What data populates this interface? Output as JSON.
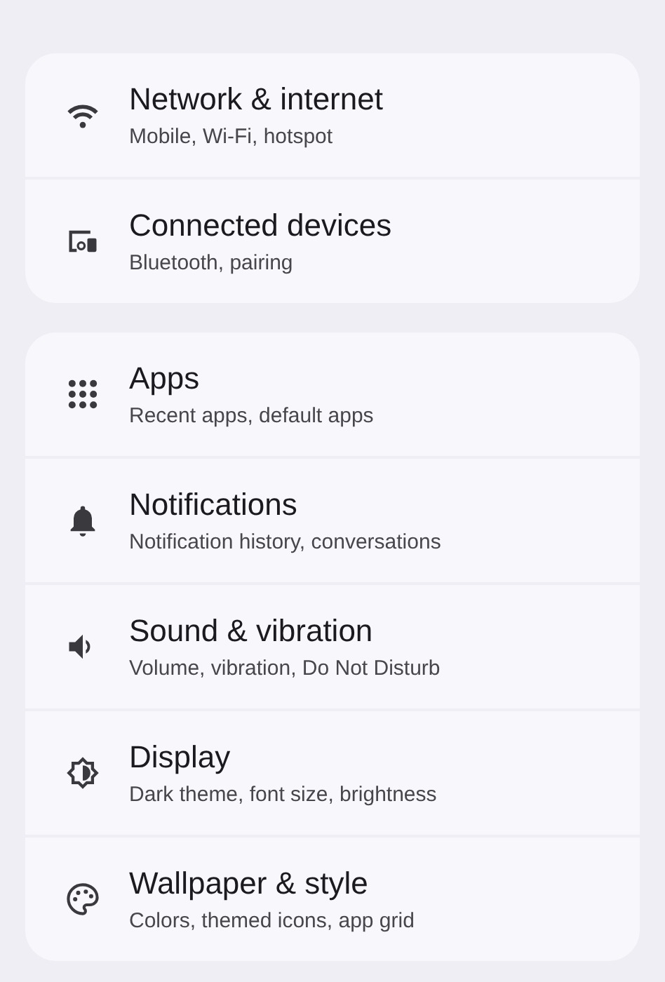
{
  "groups": [
    {
      "items": [
        {
          "kind": "wifi",
          "title": "Network & internet",
          "subtitle": "Mobile, Wi-Fi, hotspot"
        },
        {
          "kind": "devices",
          "title": "Connected devices",
          "subtitle": "Bluetooth, pairing"
        }
      ]
    },
    {
      "items": [
        {
          "kind": "apps",
          "title": "Apps",
          "subtitle": "Recent apps, default apps"
        },
        {
          "kind": "bell",
          "title": "Notifications",
          "subtitle": "Notification history, conversations"
        },
        {
          "kind": "sound",
          "title": "Sound & vibration",
          "subtitle": "Volume, vibration, Do Not Disturb"
        },
        {
          "kind": "display",
          "title": "Display",
          "subtitle": "Dark theme, font size, brightness"
        },
        {
          "kind": "palette",
          "title": "Wallpaper & style",
          "subtitle": "Colors, themed icons, app grid"
        }
      ]
    }
  ]
}
